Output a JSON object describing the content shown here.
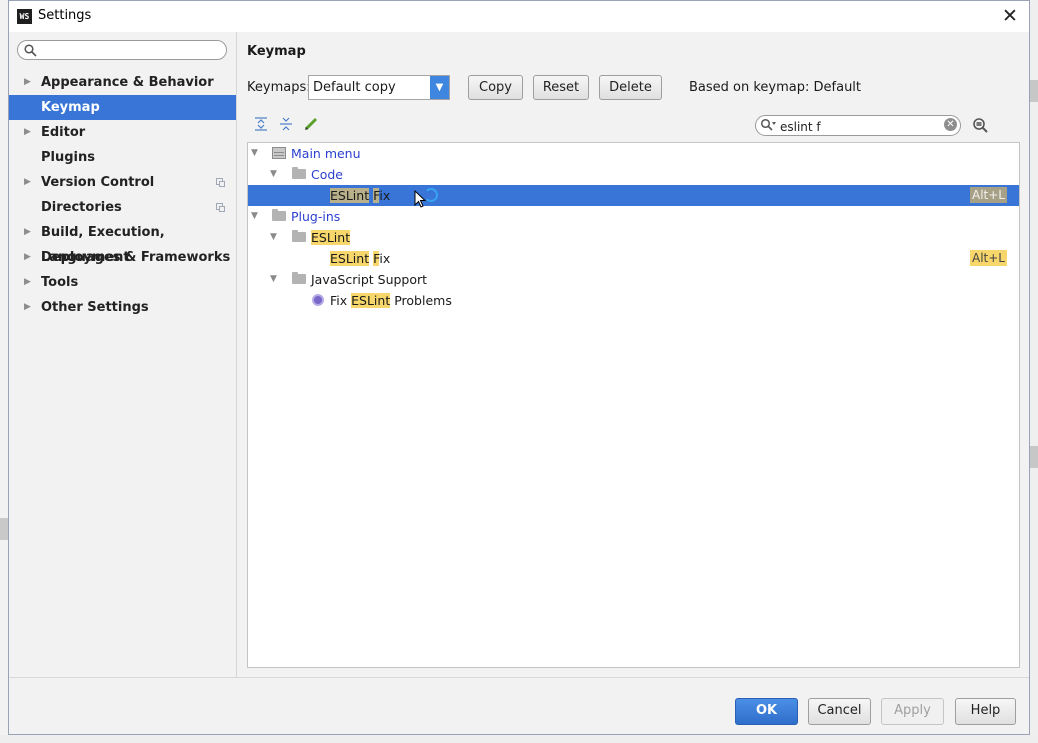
{
  "window": {
    "title": "Settings",
    "app_icon": "WS"
  },
  "sidebar": {
    "search": {
      "value": "",
      "placeholder": ""
    },
    "items": [
      {
        "label": "Appearance & Behavior",
        "expandable": true,
        "project_level": false,
        "selected": false
      },
      {
        "label": "Keymap",
        "expandable": false,
        "project_level": false,
        "selected": true
      },
      {
        "label": "Editor",
        "expandable": true,
        "project_level": false,
        "selected": false
      },
      {
        "label": "Plugins",
        "expandable": false,
        "project_level": false,
        "selected": false
      },
      {
        "label": "Version Control",
        "expandable": true,
        "project_level": true,
        "selected": false
      },
      {
        "label": "Directories",
        "expandable": false,
        "project_level": true,
        "selected": false
      },
      {
        "label": "Build, Execution, Deployment",
        "expandable": true,
        "project_level": false,
        "selected": false
      },
      {
        "label": "Languages & Frameworks",
        "expandable": true,
        "project_level": false,
        "selected": false
      },
      {
        "label": "Tools",
        "expandable": true,
        "project_level": false,
        "selected": false
      },
      {
        "label": "Other Settings",
        "expandable": true,
        "project_level": false,
        "selected": false
      }
    ]
  },
  "keymap": {
    "heading": "Keymap",
    "keymaps_label": "Keymaps:",
    "selected_keymap": "Default copy",
    "copy_label": "Copy",
    "reset_label": "Reset",
    "delete_label": "Delete",
    "based_on": "Based on keymap: Default",
    "filter_value": "eslint f",
    "tree": {
      "main_menu": "Main menu",
      "code": "Code",
      "code_action": {
        "hl1": "ESLint",
        "sep": " ",
        "hl2": "F",
        "rest": "ix",
        "shortcut": "Alt+L"
      },
      "plugins": "Plug-ins",
      "eslint_group": "ESLint",
      "eslint_action": {
        "hl1": "ESLint",
        "sep": " ",
        "hl2": "F",
        "rest": "ix",
        "shortcut": "Alt+L"
      },
      "js_support": "JavaScript Support",
      "fix_problems": {
        "pre": "Fix",
        "sep": " ",
        "hl": "ESLint",
        "rest": " Problems"
      }
    }
  },
  "footer": {
    "ok": "OK",
    "cancel": "Cancel",
    "apply": "Apply",
    "help": "Help"
  },
  "colors": {
    "selection": "#3875d6",
    "highlight": "#f7d76b",
    "link_blue": "#2b3fcf",
    "ok_button": "#3a7bd9"
  }
}
